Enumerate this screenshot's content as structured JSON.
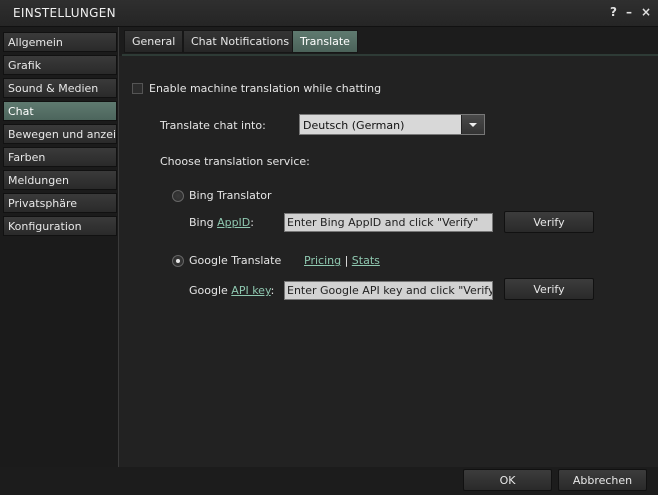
{
  "window": {
    "title": "EINSTELLUNGEN",
    "help_glyph": "?",
    "minimize_glyph": "–",
    "close_glyph": "×"
  },
  "sidebar": {
    "items": [
      {
        "label": "Allgemein"
      },
      {
        "label": "Grafik"
      },
      {
        "label": "Sound & Medien"
      },
      {
        "label": "Chat",
        "active": true
      },
      {
        "label": "Bewegen und anzeigen"
      },
      {
        "label": "Farben"
      },
      {
        "label": "Meldungen"
      },
      {
        "label": "Privatsphäre"
      },
      {
        "label": "Konfiguration"
      }
    ]
  },
  "tabs": [
    {
      "label": "General"
    },
    {
      "label": "Chat Notifications"
    },
    {
      "label": "Translate",
      "active": true
    }
  ],
  "translate": {
    "enable_label": "Enable machine translation while chatting",
    "enable_checked": false,
    "translate_into_label": "Translate chat into:",
    "language_selected": "Deutsch (German)",
    "choose_service_label": "Choose translation service:",
    "bing": {
      "label": "Bing Translator",
      "selected": false,
      "prefix": "Bing",
      "key_link": "AppID",
      "colon": ":",
      "placeholder": "Enter Bing AppID and click \"Verify\"",
      "verify_label": "Verify"
    },
    "google": {
      "label": "Google Translate",
      "selected": true,
      "pricing_link": "Pricing",
      "separator": "|",
      "stats_link": "Stats",
      "prefix": "Google",
      "key_link": "API key",
      "colon": ":",
      "placeholder": "Enter Google API key and click \"Verify\"",
      "verify_label": "Verify"
    }
  },
  "footer": {
    "ok_label": "OK",
    "cancel_label": "Abbrechen"
  },
  "colors": {
    "accent": "#5a736a",
    "link": "#8fc8b0"
  }
}
